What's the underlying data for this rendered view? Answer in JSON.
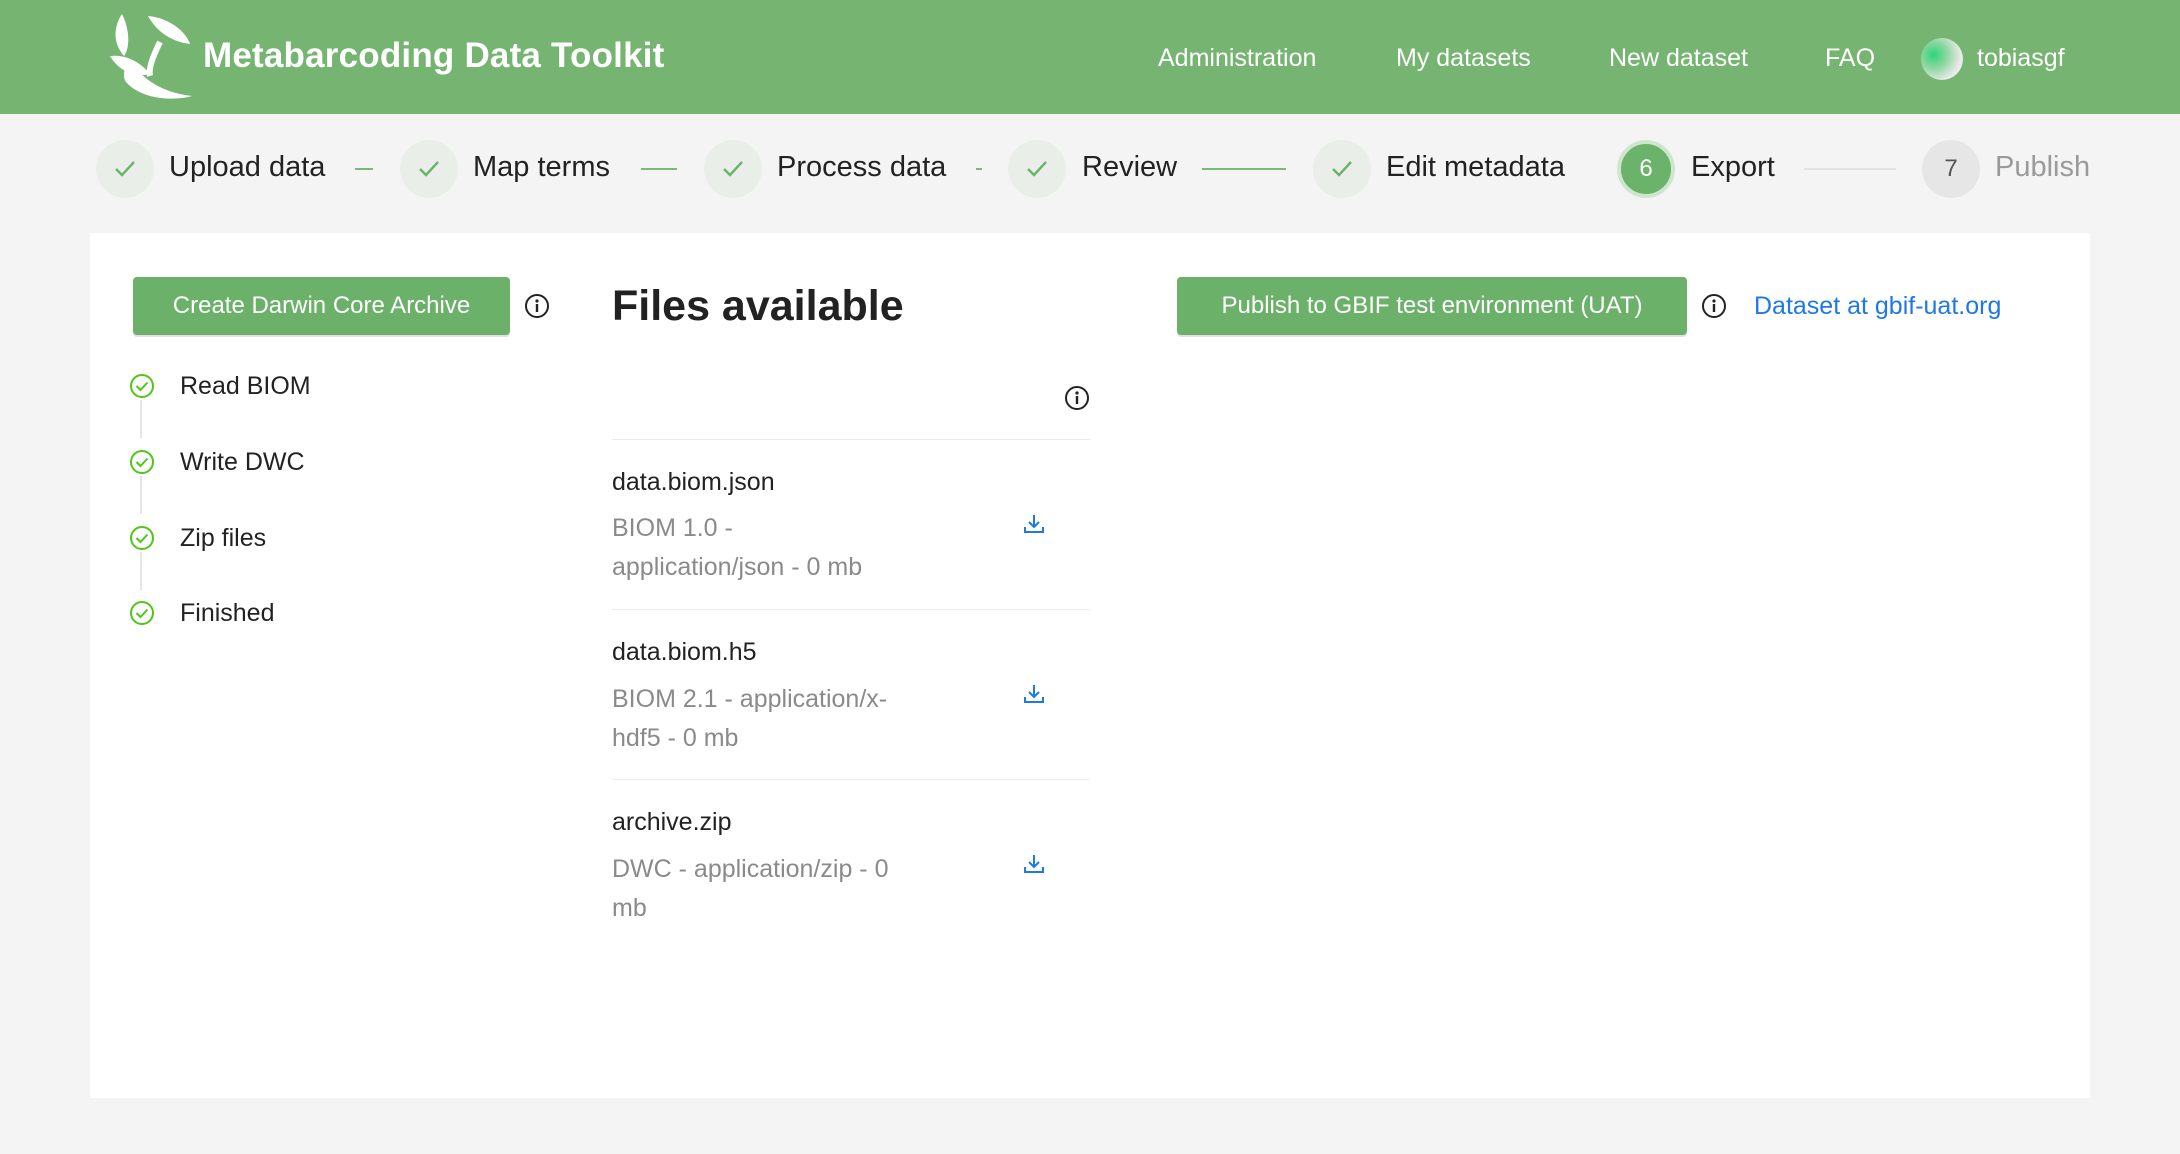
{
  "header": {
    "brand": "Metabarcoding Data Toolkit",
    "nav": [
      "Administration",
      "My datasets",
      "New dataset",
      "FAQ"
    ],
    "user": "tobiasgf"
  },
  "steps": [
    {
      "label": "Upload data",
      "state": "done"
    },
    {
      "label": "Map terms",
      "state": "done"
    },
    {
      "label": "Process data",
      "state": "done"
    },
    {
      "label": "Review",
      "state": "done"
    },
    {
      "label": "Edit metadata",
      "state": "done"
    },
    {
      "label": "Export",
      "state": "active",
      "number": "6"
    },
    {
      "label": "Publish",
      "state": "pending",
      "number": "7"
    }
  ],
  "actions": {
    "create_archive": "Create Darwin Core Archive",
    "publish": "Publish to GBIF test environment (UAT)",
    "dataset_link": "Dataset at gbif-uat.org"
  },
  "checklist": [
    "Read BIOM",
    "Write DWC",
    "Zip files",
    "Finished"
  ],
  "files": {
    "title": "Files available",
    "items": [
      {
        "name": "data.biom.json",
        "desc_line1": "BIOM 1.0 -",
        "desc_line2": "application/json - 0 mb"
      },
      {
        "name": "data.biom.h5",
        "desc_line1": "BIOM 2.1 - application/x-",
        "desc_line2": "hdf5 - 0 mb"
      },
      {
        "name": "archive.zip",
        "desc_line1": "DWC - application/zip - 0",
        "desc_line2": "mb"
      }
    ]
  },
  "colors": {
    "header": "#76b472",
    "accent": "#6cb16a",
    "check": "#52c41a",
    "link": "#1e78e6"
  }
}
